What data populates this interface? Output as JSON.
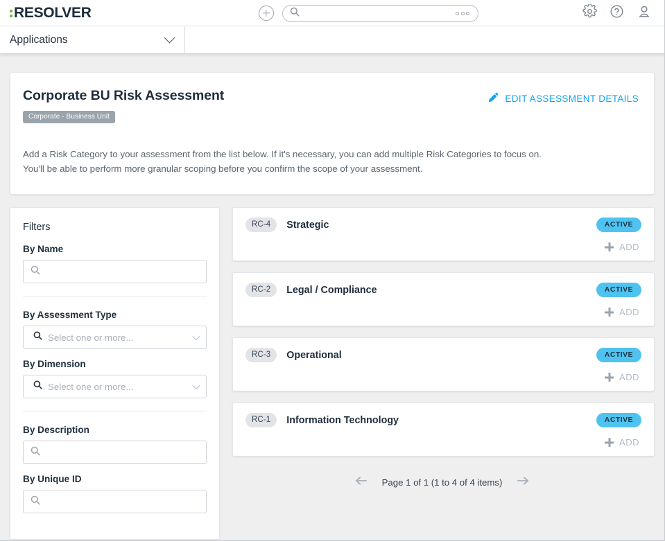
{
  "header": {
    "logo_text": "RESOLVER",
    "add_icon": "plus-circle-icon",
    "search": {
      "placeholder": "",
      "value": "",
      "search_icon": "search-icon",
      "more_icon": "ellipsis-icon"
    },
    "settings_icon": "gear-icon",
    "help_icon": "question-circle-icon",
    "profile_icon": "user-icon"
  },
  "nav": {
    "dropdown_label": "Applications",
    "dropdown_icon": "chevron-down-icon"
  },
  "assessment": {
    "title": "Corporate BU Risk Assessment",
    "type_badge": "Corporate - Business Unit",
    "edit_link": "EDIT ASSESSMENT DETAILS",
    "edit_icon": "pencil-icon",
    "description_line1": "Add a Risk Category to your assessment from the list below. If it's necessary, you can add multiple Risk Categories to focus on.",
    "description_line2": "You'll be able to perform more granular scoping before you confirm the scope of your assessment."
  },
  "filters": {
    "title": "Filters",
    "by_name": {
      "label": "By Name",
      "value": "",
      "placeholder": "",
      "icon": "search-icon"
    },
    "by_assessment_type": {
      "label": "By Assessment Type",
      "placeholder": "Select one or more...",
      "icon": "search-icon",
      "chevron": "chevron-down-icon"
    },
    "by_dimension": {
      "label": "By Dimension",
      "placeholder": "Select one or more...",
      "icon": "search-icon",
      "chevron": "chevron-down-icon"
    },
    "by_description": {
      "label": "By Description",
      "value": "",
      "placeholder": "",
      "icon": "search-icon"
    },
    "by_unique_id": {
      "label": "By Unique ID",
      "value": "",
      "placeholder": "",
      "icon": "search-icon"
    }
  },
  "risk_categories": [
    {
      "id": "RC-4",
      "name": "Strategic",
      "status": "ACTIVE",
      "add_label": "ADD"
    },
    {
      "id": "RC-2",
      "name": "Legal / Compliance",
      "status": "ACTIVE",
      "add_label": "ADD"
    },
    {
      "id": "RC-3",
      "name": "Operational",
      "status": "ACTIVE",
      "add_label": "ADD"
    },
    {
      "id": "RC-1",
      "name": "Information Technology",
      "status": "ACTIVE",
      "add_label": "ADD"
    }
  ],
  "pagination": {
    "text": "Page 1 of 1 (1 to 4 of 4 items)",
    "prev_icon": "arrow-left-icon",
    "next_icon": "arrow-right-icon"
  },
  "colors": {
    "accent_link": "#14a3e8",
    "status_active_bg": "#4fc3f0",
    "logo_green": "#7ab648",
    "page_bg": "#efeff0",
    "pill_bg": "#e2e4e7",
    "type_badge_bg": "#9ba3ab"
  }
}
